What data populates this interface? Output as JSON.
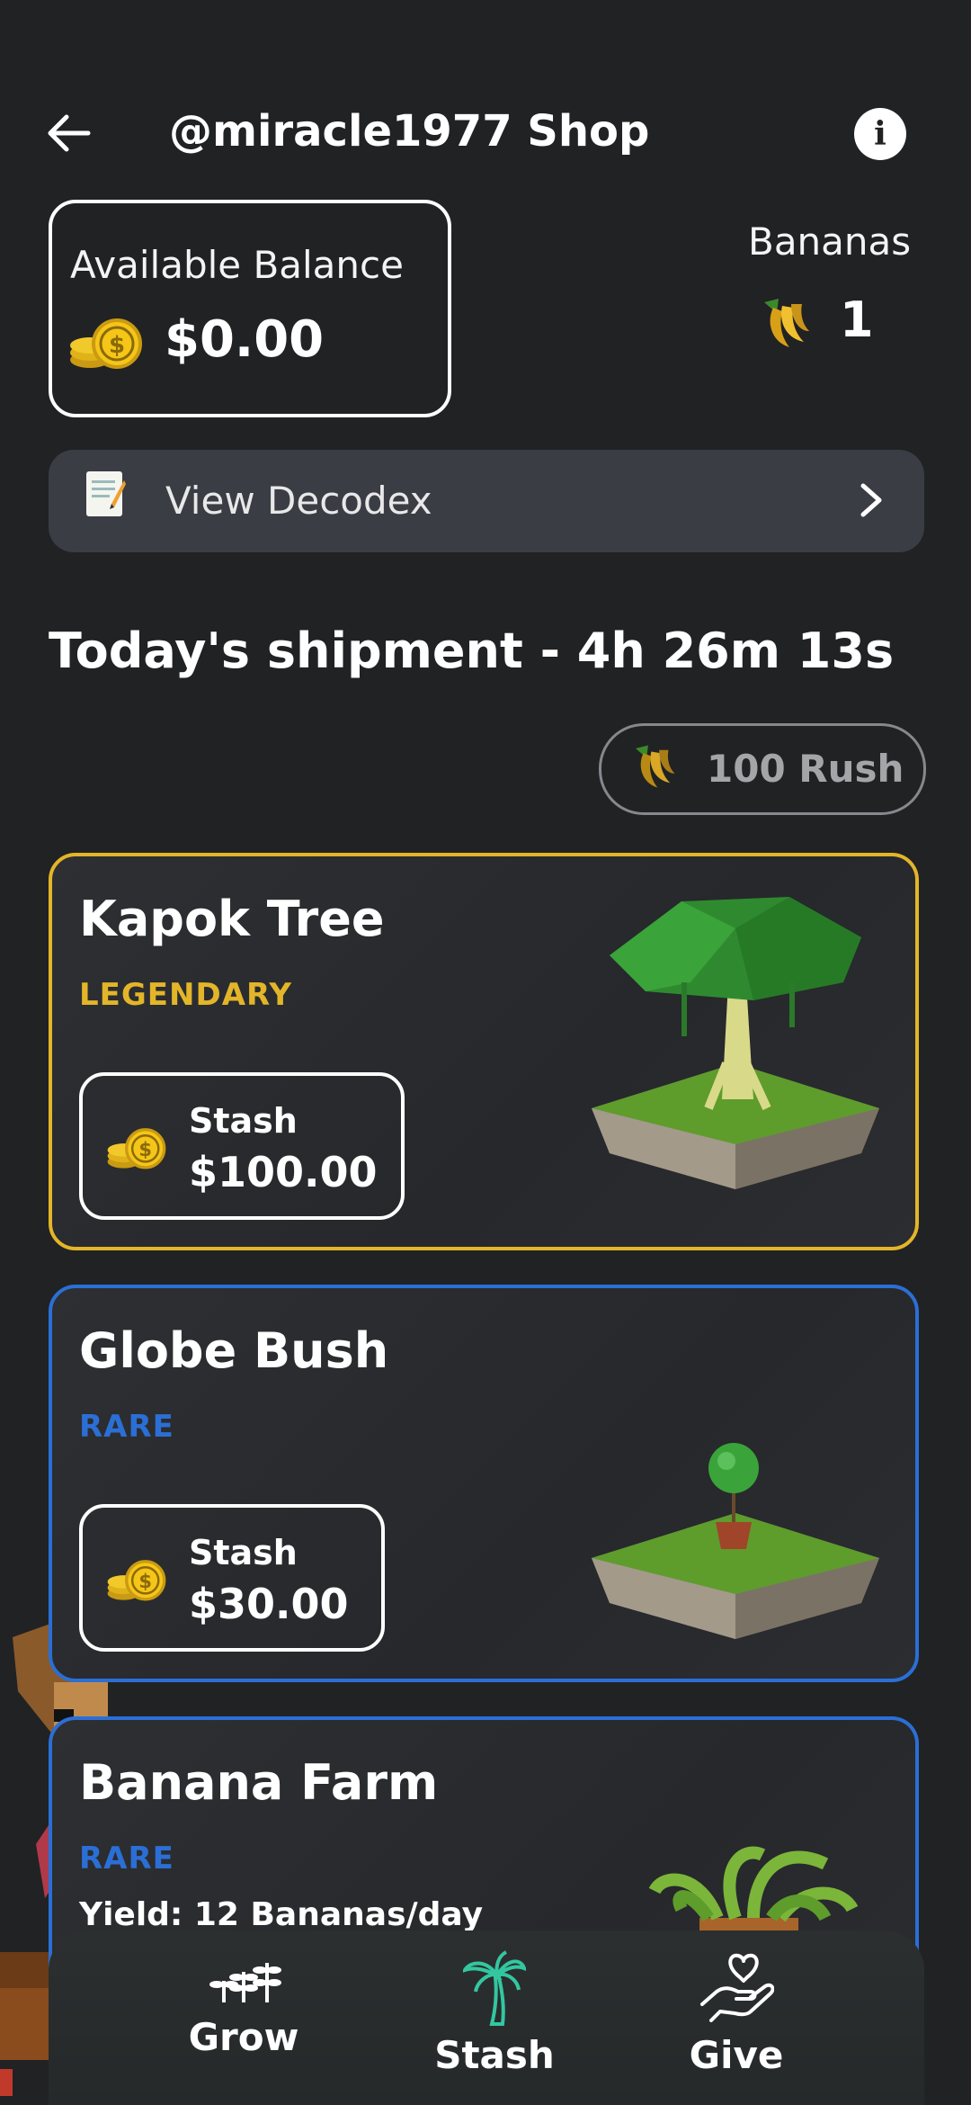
{
  "header": {
    "back_icon": "arrow-left-icon",
    "title": "@miracle1977 Shop",
    "info_icon": "info-icon"
  },
  "balance": {
    "label": "Available Balance",
    "amount": "$0.00",
    "icon": "coins-icon"
  },
  "bananas": {
    "label": "Bananas",
    "count": "1",
    "icon": "banana-icon"
  },
  "decodex": {
    "label": "View Decodex",
    "icon": "memo-icon",
    "chevron": "chevron-right-icon"
  },
  "shipment": {
    "title": "Today's shipment - 4h 26m 13s",
    "rush_label": "100 Rush",
    "rush_icon": "banana-icon"
  },
  "items": [
    {
      "name": "Kapok Tree",
      "rarity": "LEGENDARY",
      "price_label": "Stash",
      "price": "$100.00",
      "border_color": "#e3b529",
      "rarity_color": "#e3b529"
    },
    {
      "name": "Globe Bush",
      "rarity": "RARE",
      "price_label": "Stash",
      "price": "$30.00",
      "border_color": "#2b6fd6",
      "rarity_color": "#2b6fd6"
    },
    {
      "name": "Banana Farm",
      "rarity": "RARE",
      "yield": "Yield: 12 Bananas/day",
      "border_color": "#2b6fd6",
      "rarity_color": "#2b6fd6"
    }
  ],
  "nav": [
    {
      "label": "Grow",
      "icon": "sprouts-icon",
      "color": "#ffffff"
    },
    {
      "label": "Stash",
      "icon": "palm-tree-icon",
      "color": "#ffffff",
      "icon_color": "#33c7a0"
    },
    {
      "label": "Give",
      "icon": "heart-hand-icon",
      "color": "#ffffff"
    }
  ]
}
